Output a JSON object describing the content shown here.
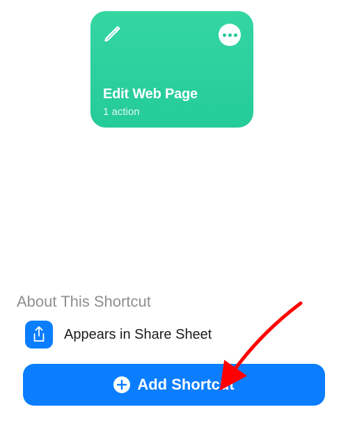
{
  "shortcut": {
    "title": "Edit Web Page",
    "subtitle": "1 action",
    "icon": "pencil-icon",
    "card_color": "#25cb9a"
  },
  "about": {
    "heading": "About This Shortcut",
    "share_sheet_label": "Appears in Share Sheet",
    "share_icon": "share-icon"
  },
  "add_button": {
    "label": "Add Shortcut",
    "icon": "plus-circle-icon"
  },
  "colors": {
    "accent_blue": "#0a7eff",
    "card_green": "#25cb9a"
  }
}
